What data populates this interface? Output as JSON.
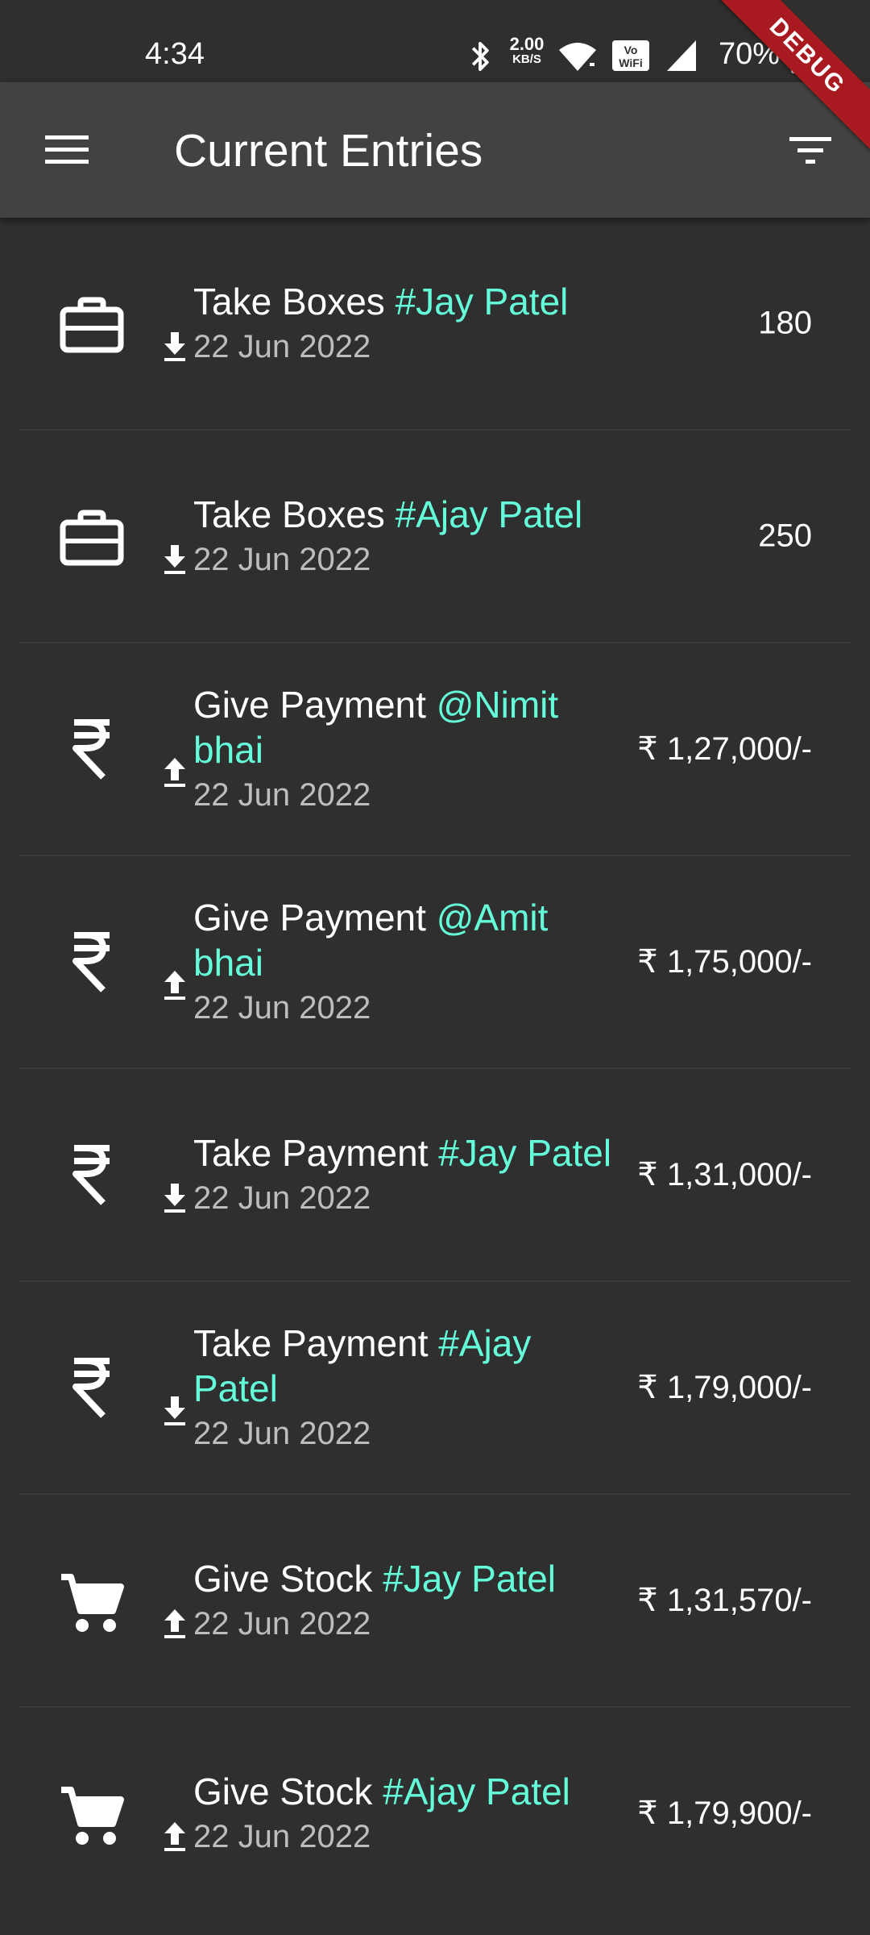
{
  "status_bar": {
    "time": "4:34",
    "net_speed_value": "2.00",
    "net_speed_unit": "KB/S",
    "battery": "70%",
    "icons": [
      "bluetooth-icon",
      "wifi-icon",
      "volte-wifi-icon",
      "cellular-signal-icon",
      "battery-icon"
    ]
  },
  "debug_banner": "DEBUG",
  "app_bar": {
    "title": "Current Entries",
    "menu_icon": "menu-icon",
    "filter_icon": "filter-icon"
  },
  "entries": [
    {
      "icon": "briefcase-icon",
      "direction": "download-icon",
      "action": "Take Boxes ",
      "party": "#Jay Patel",
      "date": "22 Jun 2022",
      "amount": "180"
    },
    {
      "icon": "briefcase-icon",
      "direction": "download-icon",
      "action": "Take Boxes ",
      "party": "#Ajay Patel",
      "date": "22 Jun 2022",
      "amount": "250"
    },
    {
      "icon": "rupee-icon",
      "direction": "upload-icon",
      "action": "Give Payment ",
      "party": "@Nimit bhai",
      "date": "22 Jun 2022",
      "amount": "₹ 1,27,000/-"
    },
    {
      "icon": "rupee-icon",
      "direction": "upload-icon",
      "action": "Give Payment ",
      "party": "@Amit bhai",
      "date": "22 Jun 2022",
      "amount": "₹ 1,75,000/-"
    },
    {
      "icon": "rupee-icon",
      "direction": "download-icon",
      "action": "Take Payment ",
      "party": "#Jay Patel",
      "date": "22 Jun 2022",
      "amount": "₹ 1,31,000/-"
    },
    {
      "icon": "rupee-icon",
      "direction": "download-icon",
      "action": "Take Payment ",
      "party": "#Ajay Patel",
      "date": "22 Jun 2022",
      "amount": "₹ 1,79,000/-"
    },
    {
      "icon": "cart-icon",
      "direction": "upload-icon",
      "action": "Give Stock ",
      "party": "#Jay Patel",
      "date": "22 Jun 2022",
      "amount": "₹ 1,31,570/-"
    },
    {
      "icon": "cart-icon",
      "direction": "upload-icon",
      "action": "Give Stock ",
      "party": "#Ajay Patel",
      "date": "22 Jun 2022",
      "amount": "₹ 1,79,900/-"
    }
  ],
  "colors": {
    "background": "#2f2f2f",
    "app_bar": "#424242",
    "accent": "#64ffda",
    "secondary_text": "#bdbdbd",
    "debug_ribbon": "#a81a1f"
  }
}
